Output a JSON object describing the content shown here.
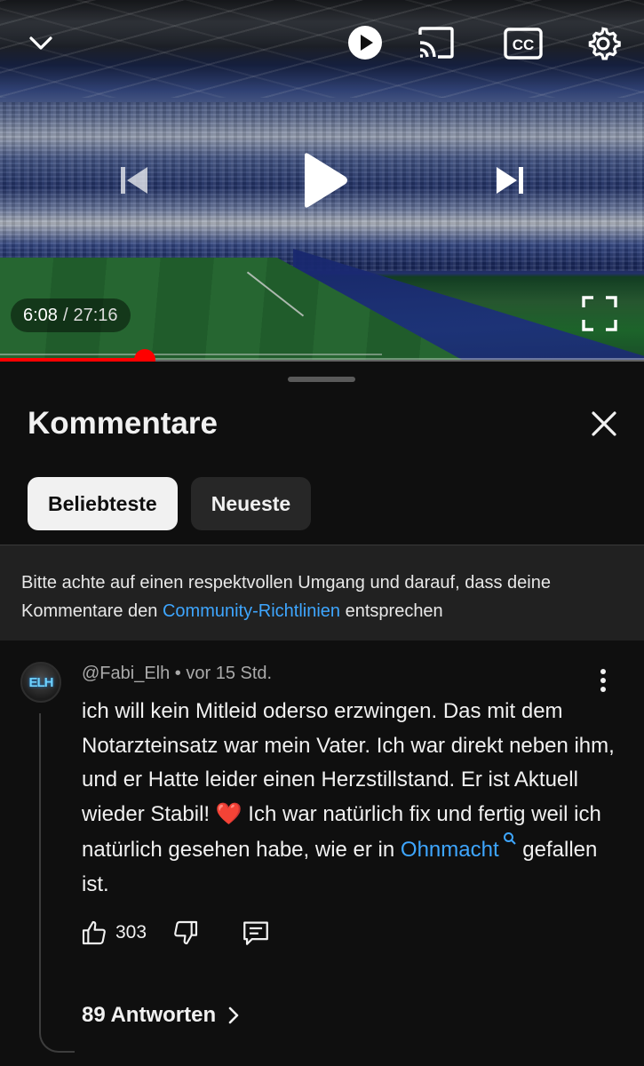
{
  "player": {
    "current_time": "6:08",
    "separator": "/",
    "duration": "27:16",
    "progress_fraction": 0.225,
    "icons": [
      "chevron-down-icon",
      "autoplay-play-icon",
      "cast-icon",
      "captions-icon",
      "settings-icon",
      "previous-icon",
      "play-icon",
      "next-icon",
      "fullscreen-icon"
    ],
    "captions_label": "CC"
  },
  "comments_sheet": {
    "title": "Kommentare",
    "sort_chips": [
      {
        "label": "Beliebteste",
        "active": true
      },
      {
        "label": "Neueste",
        "active": false
      }
    ],
    "notice": {
      "text_before": "Bitte achte auf einen respektvollen Umgang und darauf, dass deine Kommentare den ",
      "link": "Community-Richtlinien",
      "text_after": " entsprechen"
    }
  },
  "comment": {
    "author": "@Fabi_Elh",
    "separator": " • ",
    "time": "vor 15 Std.",
    "avatar_text": "ELH",
    "body_part1": "ich will kein Mitleid oderso erzwingen. Das mit dem Notarzteinsatz war mein Vater. Ich war direkt neben ihm, und er Hatte leider einen Herzstillstand. Er ist Aktuell wieder Stabil! ",
    "heart_emoji": "❤️",
    "body_part2": " Ich war natürlich fix und fertig weil ich natürlich gesehen habe, wie er in ",
    "body_link": "Ohnmacht",
    "body_part3": " gefallen ist.",
    "likes": "303",
    "replies_label": "89 Antworten"
  },
  "colors": {
    "background": "#0f0f0f",
    "link": "#3ea6ff",
    "progress": "#ff0000",
    "notice_bg": "#212121",
    "chip_active_bg": "#f1f1f1",
    "chip_inactive_bg": "#272727"
  }
}
